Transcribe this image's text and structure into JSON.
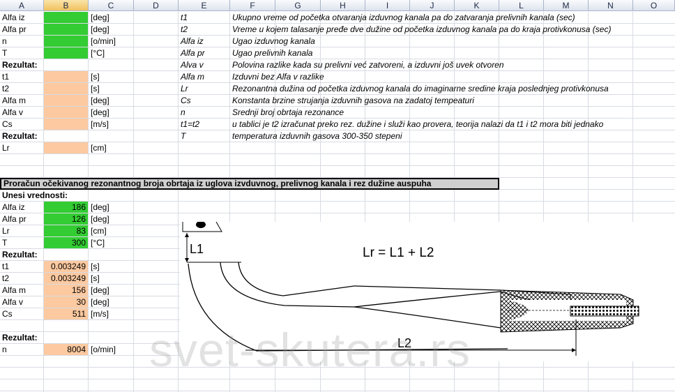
{
  "columns": [
    "A",
    "B",
    "C",
    "D",
    "E",
    "F",
    "G",
    "H",
    "I",
    "J",
    "K",
    "L",
    "M",
    "N",
    "O"
  ],
  "top_section": [
    {
      "a": "Alfa iz",
      "b_fill": "green",
      "c": "[deg]"
    },
    {
      "a": "Alfa pr",
      "b_fill": "green",
      "c": "[deg]"
    },
    {
      "a": "n",
      "b_fill": "green",
      "c": "[o/min]"
    },
    {
      "a": "T",
      "b_fill": "green",
      "c": "[°C]"
    },
    {
      "a": "Rezultat:",
      "bold": true
    },
    {
      "a": "t1",
      "b_fill": "peach",
      "c": "[s]"
    },
    {
      "a": "t2",
      "b_fill": "peach",
      "c": "[s]"
    },
    {
      "a": "Alfa m",
      "b_fill": "peach",
      "c": "[deg]"
    },
    {
      "a": "Alfa v",
      "b_fill": "peach",
      "c": "[deg]"
    },
    {
      "a": "Cs",
      "b_fill": "peach",
      "c": "[m/s]"
    },
    {
      "a": "Rezultat:",
      "bold": true
    },
    {
      "a": "Lr",
      "b_fill": "peach",
      "c": "[cm]"
    }
  ],
  "legend": [
    {
      "sym": "t1",
      "desc": "Ukupno vreme od početka otvaranja izduvnog kanala pa do zatvaranja prelivnih kanala (sec)"
    },
    {
      "sym": "t2",
      "desc": "Vreme u kojem talasanje pređe dve dužine od početka izduvnog kanala pa do kraja protivkonusa (sec)"
    },
    {
      "sym": "Alfa iz",
      "desc": "Ugao izduvnog kanala"
    },
    {
      "sym": "Alfa pr",
      "desc": "Ugao prelivnih kanala"
    },
    {
      "sym": "Alva v",
      "desc": "Polovina razlike kada su prelivni već zatvoreni, a izduvni još uvek otvoren"
    },
    {
      "sym": "Alfa m",
      "desc": "Izduvni bez Alfa v razlike"
    },
    {
      "sym": "Lr",
      "desc": "Rezonantna dužina od početka izduvnog kanala do imaginarne sredine kraja poslednjeg protivkonusa"
    },
    {
      "sym": "Cs",
      "desc": "Konstanta brzine strujanja izduvnih gasova na zadatoj tempeaturi"
    },
    {
      "sym": "n",
      "desc": "Srednji broj obrtaja rezonance"
    },
    {
      "sym": "t1=t2",
      "desc": "u tablici je t2 izračunat preko rez. dužine i služi kao provera, teorija nalazi da t1 i t2 mora biti jednako"
    },
    {
      "sym": "T",
      "desc": "temperatura izduvnih gasova 300-350 stepeni"
    }
  ],
  "section2": {
    "title": "Proračun očekivanog rezonantnog broja obrtaja iz uglova izvduvnog, prelivnog kanala i rez dužine auspuha",
    "input_label": "Unesi vrednosti:",
    "inputs": [
      {
        "label": "Alfa iz",
        "value": "186",
        "unit": "[deg]"
      },
      {
        "label": "Alfa pr",
        "value": "126",
        "unit": "[deg]"
      },
      {
        "label": "Lr",
        "value": "83",
        "unit": "[cm]"
      },
      {
        "label": "T",
        "value": "300",
        "unit": "[°C]"
      }
    ],
    "result_label": "Rezultat:",
    "results": [
      {
        "label": "t1",
        "value": "0.003249",
        "unit": "[s]"
      },
      {
        "label": "t2",
        "value": "0.003249",
        "unit": "[s]"
      },
      {
        "label": "Alfa m",
        "value": "156",
        "unit": "[deg]"
      },
      {
        "label": "Alfa v",
        "value": "30",
        "unit": "[deg]"
      },
      {
        "label": "Cs",
        "value": "511",
        "unit": "[m/s]"
      }
    ],
    "final_label": "Rezultat:",
    "final": {
      "label": "n",
      "value": "8004",
      "unit": "[o/min]"
    }
  },
  "diagram": {
    "formula": "Lr = L1 + L2",
    "l1": "L1",
    "l2": "L2"
  },
  "watermark": "svet-skutera.rs",
  "colors": {
    "input": "#33cc33",
    "result": "#fcc9a0",
    "header": "#dde3ee"
  }
}
